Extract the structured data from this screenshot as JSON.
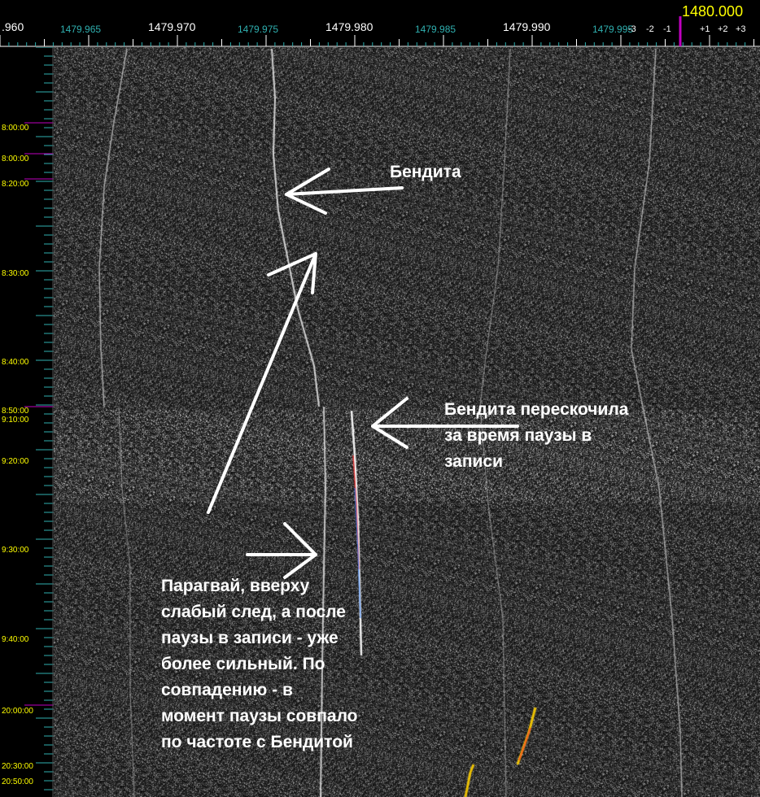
{
  "frequency_axis": {
    "center_readout": "1480.000",
    "major_labels": [
      ".960",
      "1479.970",
      "1479.980",
      "1479.990"
    ],
    "minor_labels": [
      "1479.965",
      "1479.975",
      "1479.985",
      "1479.995"
    ],
    "relative_labels": [
      "-3",
      "-2",
      "-1",
      "+1",
      "+2",
      "+3"
    ]
  },
  "time_axis": {
    "labels": [
      "8:00:00",
      "8:00:00",
      "8:20:00",
      "8:30:00",
      "8:40:00",
      "8:50:00",
      "9:10:00",
      "9:20:00",
      "9:30:00",
      "9:40:00",
      "20:00:00",
      "20:30:00",
      "20:50:00"
    ]
  },
  "annotations": {
    "bendita": "Бендита",
    "bendita_jump": "Бендита перескочила\nза время паузы в\nзаписи",
    "paraguay": "Парагвай, вверху\nслабый след, а после\nпаузы в записи - уже\nболее сильный. По\nсовпадению - в\nмомент паузы совпало\nпо частоте с Бендитой"
  },
  "colors": {
    "axis_tick": "#2fb0b0",
    "marker": "#c000c0",
    "readout": "#ffff00",
    "trace": "#ffffff",
    "highlight_red": "#ff3030",
    "highlight_blue": "#3080ff",
    "highlight_yellow": "#ffd000"
  }
}
